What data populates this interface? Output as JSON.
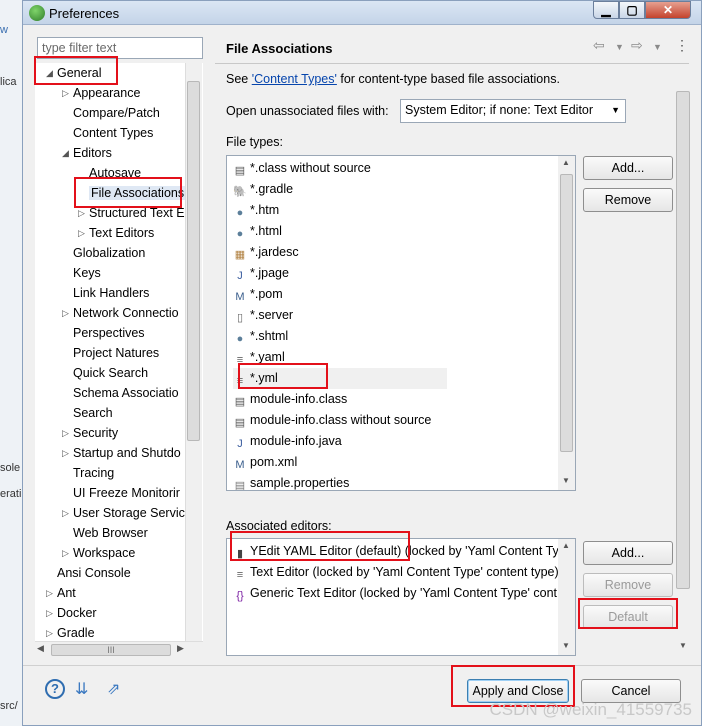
{
  "background": {
    "fragments": [
      "w",
      "lica",
      "sole",
      "erati",
      "src/"
    ]
  },
  "window": {
    "title": "Preferences"
  },
  "filter": {
    "placeholder": "type filter text"
  },
  "tree": {
    "items": [
      {
        "label": "General",
        "expanded": true
      },
      {
        "label": "Appearance"
      },
      {
        "label": "Compare/Patch"
      },
      {
        "label": "Content Types"
      },
      {
        "label": "Editors",
        "expanded": true
      },
      {
        "label": "Autosave"
      },
      {
        "label": "File Associations",
        "selected": true
      },
      {
        "label": "Structured Text E"
      },
      {
        "label": "Text Editors"
      },
      {
        "label": "Globalization"
      },
      {
        "label": "Keys"
      },
      {
        "label": "Link Handlers"
      },
      {
        "label": "Network Connectio"
      },
      {
        "label": "Perspectives"
      },
      {
        "label": "Project Natures"
      },
      {
        "label": "Quick Search"
      },
      {
        "label": "Schema Associatio"
      },
      {
        "label": "Search"
      },
      {
        "label": "Security"
      },
      {
        "label": "Startup and Shutdo"
      },
      {
        "label": "Tracing"
      },
      {
        "label": "UI Freeze Monitorir"
      },
      {
        "label": "User Storage Servic"
      },
      {
        "label": "Web Browser"
      },
      {
        "label": "Workspace"
      },
      {
        "label": "Ansi Console"
      },
      {
        "label": "Ant"
      },
      {
        "label": "Docker"
      },
      {
        "label": "Gradle"
      }
    ],
    "hscroll_mark": "III"
  },
  "page": {
    "title": "File Associations",
    "see_prefix": "See ",
    "see_link": "'Content Types'",
    "see_suffix": " for content-type based file associations.",
    "open_label": "Open unassociated files with:",
    "open_value": "System Editor; if none: Text Editor",
    "file_types_label": "File types:",
    "file_types": [
      {
        "icon": "class-file-icon",
        "name": "*.class without source"
      },
      {
        "icon": "gradle-icon",
        "name": "*.gradle"
      },
      {
        "icon": "globe-icon",
        "name": "*.htm"
      },
      {
        "icon": "globe-icon",
        "name": "*.html"
      },
      {
        "icon": "jar-description-icon",
        "name": "*.jardesc"
      },
      {
        "icon": "java-page-icon",
        "name": "*.jpage"
      },
      {
        "icon": "maven-pom-icon",
        "name": "*.pom"
      },
      {
        "icon": "server-icon",
        "name": "*.server"
      },
      {
        "icon": "globe-icon",
        "name": "*.shtml"
      },
      {
        "icon": "text-file-icon",
        "name": "*.yaml"
      },
      {
        "icon": "text-file-icon",
        "name": "*.yml",
        "selected": true
      },
      {
        "icon": "class-file-icon",
        "name": "module-info.class"
      },
      {
        "icon": "class-file-icon",
        "name": "module-info.class without source"
      },
      {
        "icon": "java-file-icon",
        "name": "module-info.java"
      },
      {
        "icon": "maven-pom-icon",
        "name": "pom.xml"
      },
      {
        "icon": "properties-file-icon",
        "name": "sample.properties"
      }
    ],
    "add_label": "Add...",
    "remove_label": "Remove",
    "assoc_label": "Associated editors:",
    "editors": [
      {
        "icon": "yedit-icon",
        "name": "YEdit YAML Editor (default)",
        "suffix": " (locked by 'Yaml Content Ty"
      },
      {
        "icon": "text-file-icon",
        "name": "Text Editor (locked by 'Yaml Content Type' content type)",
        "suffix": ""
      },
      {
        "icon": "generic-editor-icon",
        "name": "Generic Text Editor (locked by 'Yaml Content Type' cont",
        "suffix": ""
      }
    ],
    "add2_label": "Add...",
    "remove2_label": "Remove",
    "default_label": "Default"
  },
  "footer": {
    "apply_close": "Apply and Close",
    "cancel": "Cancel"
  },
  "watermark": "CSDN @weixin_41559735",
  "colors": {
    "highlight": "#e3101a",
    "link": "#0645ad"
  }
}
